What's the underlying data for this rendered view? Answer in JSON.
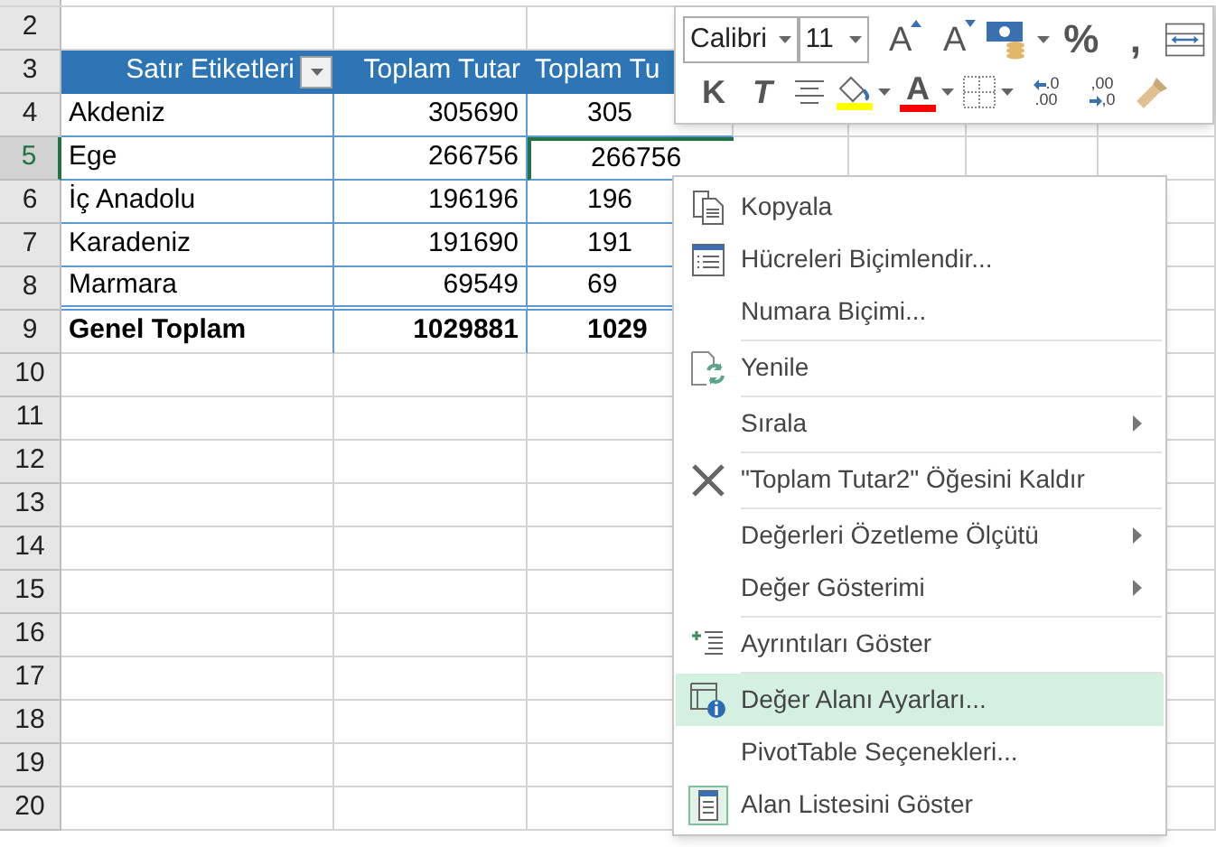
{
  "sheet": {
    "rows": [
      {
        "number": "2",
        "kind": "blank",
        "selected": false
      },
      {
        "number": "3",
        "kind": "header",
        "selected": false,
        "cells": [
          "Satır Etiketleri",
          "Toplam Tutar",
          "Toplam Tu"
        ]
      },
      {
        "number": "4",
        "kind": "data",
        "selected": false,
        "cells": [
          "Akdeniz",
          "305690",
          "305"
        ]
      },
      {
        "number": "5",
        "kind": "data",
        "selected": true,
        "cells": [
          "Ege",
          "266756",
          "266756"
        ]
      },
      {
        "number": "6",
        "kind": "data",
        "selected": false,
        "cells": [
          "İç Anadolu",
          "196196",
          "196"
        ]
      },
      {
        "number": "7",
        "kind": "data",
        "selected": false,
        "cells": [
          "Karadeniz",
          "191690",
          "191"
        ]
      },
      {
        "number": "8",
        "kind": "data",
        "selected": false,
        "cells": [
          "Marmara",
          "69549",
          "69"
        ]
      },
      {
        "number": "9",
        "kind": "total",
        "selected": false,
        "cells": [
          "Genel Toplam",
          "1029881",
          "1029"
        ]
      },
      {
        "number": "10",
        "kind": "blank",
        "selected": false
      },
      {
        "number": "11",
        "kind": "blank",
        "selected": false
      },
      {
        "number": "12",
        "kind": "blank",
        "selected": false
      },
      {
        "number": "13",
        "kind": "blank",
        "selected": false
      },
      {
        "number": "14",
        "kind": "blank",
        "selected": false
      },
      {
        "number": "15",
        "kind": "blank",
        "selected": false
      },
      {
        "number": "16",
        "kind": "blank",
        "selected": false
      },
      {
        "number": "17",
        "kind": "blank",
        "selected": false
      },
      {
        "number": "18",
        "kind": "blank",
        "selected": false
      },
      {
        "number": "19",
        "kind": "blank",
        "selected": false
      },
      {
        "number": "20",
        "kind": "blank",
        "selected": false
      }
    ]
  },
  "mini_toolbar": {
    "font": "Calibri",
    "size": "11",
    "row1": [
      {
        "kind": "grow",
        "label": "A"
      },
      {
        "kind": "shrink",
        "label": "A"
      },
      {
        "kind": "accounting"
      },
      {
        "kind": "text",
        "label": "%"
      },
      {
        "kind": "text",
        "label": ","
      },
      {
        "kind": "wrap"
      }
    ],
    "row2": [
      {
        "kind": "bold",
        "label": "K"
      },
      {
        "kind": "italic",
        "label": "T"
      },
      {
        "kind": "center"
      },
      {
        "kind": "fill",
        "color": "#ffff00"
      },
      {
        "kind": "fontcolor",
        "label": "A",
        "color": "#ff0000"
      },
      {
        "kind": "borders"
      },
      {
        "kind": "incdec",
        "label": ".0",
        "label2": ".00"
      },
      {
        "kind": "decdec",
        "label": ",00",
        "label2": ",0"
      },
      {
        "kind": "painter"
      }
    ]
  },
  "context_menu": {
    "items": [
      {
        "kind": "item",
        "label": "Kopyala",
        "submenu": false,
        "highlighted": false
      },
      {
        "kind": "item",
        "label": "Hücreleri Biçimlendir...",
        "submenu": false,
        "highlighted": false
      },
      {
        "kind": "item",
        "label": "Numara Biçimi...",
        "submenu": false,
        "highlighted": false
      },
      {
        "kind": "separator"
      },
      {
        "kind": "item",
        "label": "Yenile",
        "submenu": false,
        "highlighted": false
      },
      {
        "kind": "separator"
      },
      {
        "kind": "item",
        "label": "Sırala",
        "submenu": true,
        "highlighted": false
      },
      {
        "kind": "separator"
      },
      {
        "kind": "item",
        "label": "\"Toplam Tutar2\" Öğesini Kaldır",
        "submenu": false,
        "highlighted": false
      },
      {
        "kind": "separator"
      },
      {
        "kind": "item",
        "label": "Değerleri Özetleme Ölçütü",
        "submenu": true,
        "highlighted": false
      },
      {
        "kind": "item",
        "label": "Değer Gösterimi",
        "submenu": true,
        "highlighted": false
      },
      {
        "kind": "separator"
      },
      {
        "kind": "item",
        "label": "Ayrıntıları Göster",
        "submenu": false,
        "highlighted": false
      },
      {
        "kind": "separator"
      },
      {
        "kind": "item",
        "label": "Değer Alanı Ayarları...",
        "submenu": false,
        "highlighted": true
      },
      {
        "kind": "item",
        "label": "PivotTable Seçenekleri...",
        "submenu": false,
        "highlighted": false
      },
      {
        "kind": "item",
        "label": "Alan Listesini Göster",
        "submenu": false,
        "highlighted": false
      }
    ]
  }
}
